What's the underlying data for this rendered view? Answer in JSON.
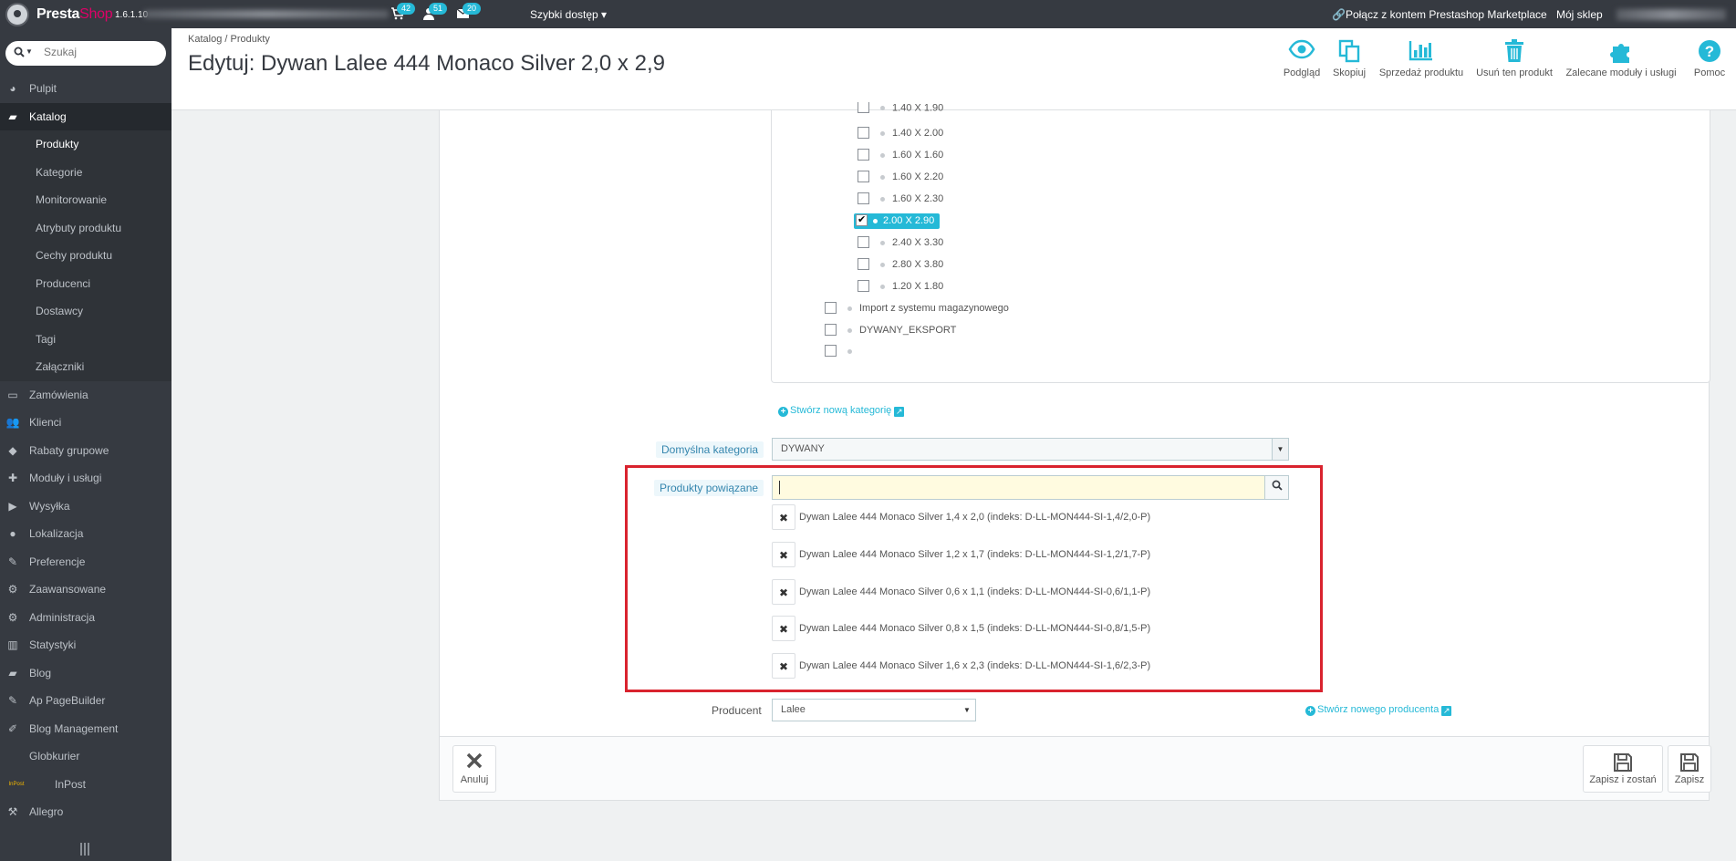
{
  "topbar": {
    "logo_presta": "Presta",
    "logo_shop": "Shop",
    "version": "1.6.1.10",
    "badges": {
      "orders": "42",
      "customers": "51",
      "messages": "20"
    },
    "quick_access": "Szybki dostęp ▾",
    "connect": "Połącz z kontem Prestashop Marketplace",
    "my_shop": "Mój sklep"
  },
  "sidebar": {
    "search_placeholder": "Szukaj",
    "items": [
      {
        "label": "Pulpit",
        "icon": "dashboard-icon"
      },
      {
        "label": "Katalog",
        "icon": "book-icon",
        "active": true
      },
      {
        "label": "Zamówienia",
        "icon": "credit-card-icon"
      },
      {
        "label": "Klienci",
        "icon": "users-icon"
      },
      {
        "label": "Rabaty grupowe",
        "icon": "tag-icon"
      },
      {
        "label": "Moduły i usługi",
        "icon": "puzzle-icon"
      },
      {
        "label": "Wysyłka",
        "icon": "truck-icon"
      },
      {
        "label": "Lokalizacja",
        "icon": "globe-icon"
      },
      {
        "label": "Preferencje",
        "icon": "wrench-icon"
      },
      {
        "label": "Zaawansowane",
        "icon": "cogs-icon"
      },
      {
        "label": "Administracja",
        "icon": "gear-icon"
      },
      {
        "label": "Statystyki",
        "icon": "bar-chart-icon"
      },
      {
        "label": "Blog",
        "icon": "book-icon"
      },
      {
        "label": "Ap PageBuilder",
        "icon": "edit-icon"
      },
      {
        "label": "Blog Management",
        "icon": "pencil-icon"
      },
      {
        "label": "Globkurier",
        "icon": ""
      },
      {
        "label": "InPost",
        "icon": "inpost-logo-icon"
      },
      {
        "label": "Allegro",
        "icon": "gavel-icon"
      }
    ],
    "subitems": [
      "Produkty",
      "Kategorie",
      "Monitorowanie",
      "Atrybuty produktu",
      "Cechy produktu",
      "Producenci",
      "Dostawcy",
      "Tagi",
      "Załączniki"
    ]
  },
  "header": {
    "breadcrumb": "Katalog  /  Produkty",
    "title": "Edytuj: Dywan Lalee 444 Monaco Silver 2,0 x 2,9",
    "toolbar": [
      "Podgląd",
      "Skopiuj",
      "Sprzedaż produktu",
      "Usuń ten produkt",
      "Zalecane moduły i usługi",
      "Pomoc"
    ]
  },
  "tree": {
    "sizes": [
      {
        "label": "1.40 X 1.90",
        "checked": false
      },
      {
        "label": "1.40 X 2.00",
        "checked": false
      },
      {
        "label": "1.60 X 1.60",
        "checked": false
      },
      {
        "label": "1.60 X 2.20",
        "checked": false
      },
      {
        "label": "1.60 X 2.30",
        "checked": false
      },
      {
        "label": "2.00 X 2.90",
        "checked": true
      },
      {
        "label": "2.40 X 3.30",
        "checked": false
      },
      {
        "label": "2.80 X 3.80",
        "checked": false
      },
      {
        "label": "1.20 X 1.80",
        "checked": false
      }
    ],
    "root": [
      {
        "label": "Import z systemu magazynowego",
        "checked": false
      },
      {
        "label": "DYWANY_EKSPORT",
        "checked": false
      },
      {
        "label": "",
        "checked": false
      }
    ],
    "create_category": "Stwórz nową kategorię"
  },
  "form": {
    "default_category_label": "Domyślna kategoria",
    "default_category_value": "DYWANY",
    "related_label": "Produkty powiązane",
    "related_input_value": "",
    "related": [
      "Dywan Lalee 444 Monaco Silver 1,4 x 2,0 (indeks: D-LL-MON444-SI-1,4/2,0-P)",
      "Dywan Lalee 444 Monaco Silver 1,2 x 1,7 (indeks: D-LL-MON444-SI-1,2/1,7-P)",
      "Dywan Lalee 444 Monaco Silver 0,6 x 1,1 (indeks: D-LL-MON444-SI-0,6/1,1-P)",
      "Dywan Lalee 444 Monaco Silver 0,8 x 1,5 (indeks: D-LL-MON444-SI-0,8/1,5-P)",
      "Dywan Lalee 444 Monaco Silver 1,6 x 2,3 (indeks: D-LL-MON444-SI-1,6/2,3-P)"
    ],
    "producer_label": "Producent",
    "producer_value": "Lalee",
    "create_producer": "Stwórz nowego producenta"
  },
  "footer": {
    "cancel": "Anuluj",
    "save_stay": "Zapisz i zostań",
    "save": "Zapisz"
  },
  "colors": {
    "accent": "#25b9d7",
    "sidebar": "#363a41",
    "highlight": "#d9232e"
  }
}
